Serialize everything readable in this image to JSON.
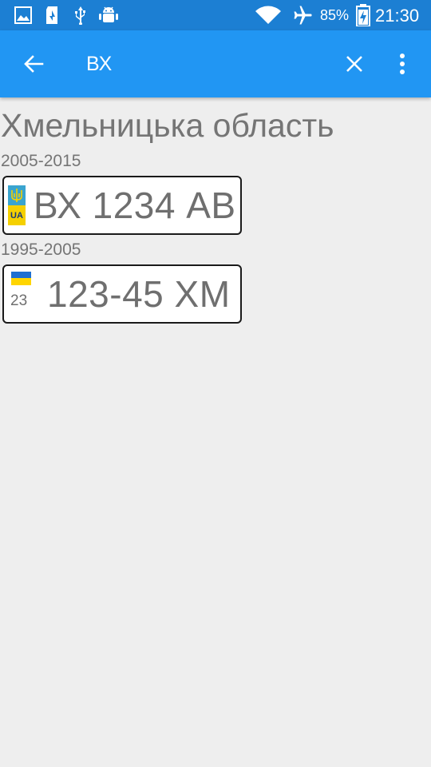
{
  "status_bar": {
    "battery_percent": "85%",
    "time": "21:30",
    "icons": [
      "image-icon",
      "sd-card-icon",
      "usb-icon",
      "android-debug-icon",
      "wifi-icon",
      "airplane-icon",
      "battery-charging-icon"
    ]
  },
  "app_bar": {
    "query": "ВХ",
    "back_icon": "arrow-left-icon",
    "clear_icon": "close-icon",
    "menu_icon": "more-vert-icon"
  },
  "region": {
    "title": "Хмельницька область"
  },
  "plates": [
    {
      "period": "2005-2015",
      "number": "ВХ 1234 АВ",
      "country_code": "UA",
      "style": "eu-strip"
    },
    {
      "period": "1995-2005",
      "number": "123-45 ХМ",
      "region_code": "23",
      "style": "flag"
    }
  ],
  "colors": {
    "status_bar": "#1c7fd3",
    "app_bar": "#2196f3",
    "background": "#eeeeee",
    "text_gray": "#757575"
  }
}
